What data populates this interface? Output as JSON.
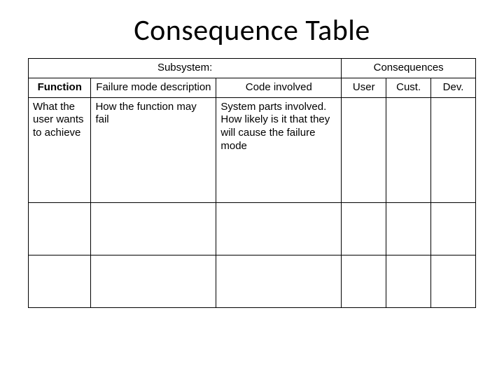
{
  "title": "Consequence Table",
  "headers": {
    "subsystem": "Subsystem:",
    "consequences": "Consequences",
    "function": "Function",
    "failure_mode": "Failure mode description",
    "code_involved": "Code involved",
    "user": "User",
    "cust": "Cust.",
    "dev": "Dev."
  },
  "rows": [
    {
      "function": "What the user wants to achieve",
      "failure_mode": "How the function may fail",
      "code_line1": "System parts involved.",
      "code_line2": "How likely is it that they will cause the failure mode",
      "user": "",
      "cust": "",
      "dev": ""
    }
  ]
}
